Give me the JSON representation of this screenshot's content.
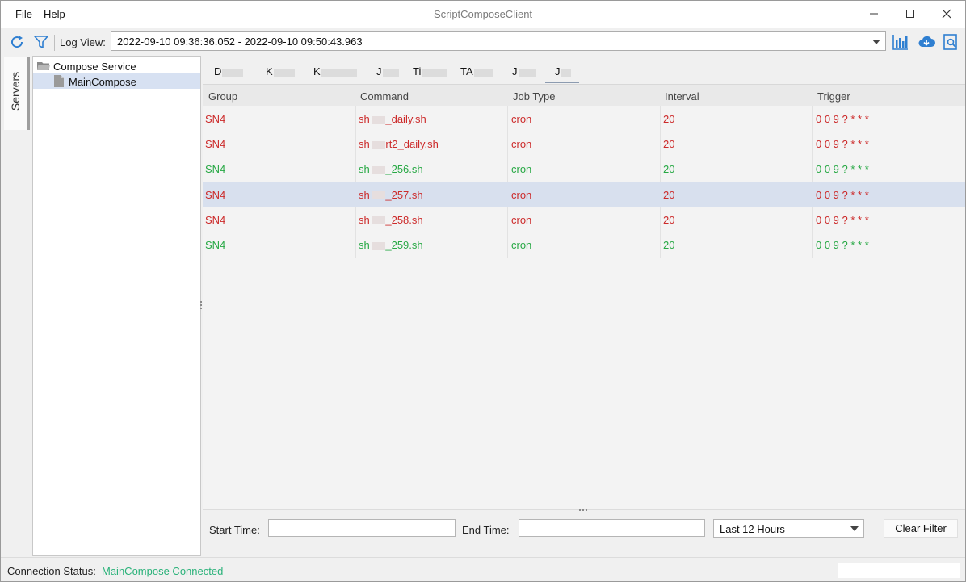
{
  "window": {
    "title": "ScriptComposeClient"
  },
  "menu": {
    "file": "File",
    "help": "Help"
  },
  "toolbar": {
    "refresh_icon": "refresh-icon",
    "filter_icon": "filter-icon",
    "log_view_label": "Log View:",
    "log_view_value": "2022-09-10 09:36:36.052 - 2022-09-10 09:50:43.963",
    "chart_icon": "chart-icon",
    "download_icon": "cloud-download-icon",
    "report_icon": "search-report-icon"
  },
  "sidebar": {
    "servers_tab": "Servers"
  },
  "tree": {
    "root": "Compose Service",
    "child": "MainCompose"
  },
  "tabs": [
    {
      "label": "D"
    },
    {
      "label": "K"
    },
    {
      "label": "K"
    },
    {
      "label": "J"
    },
    {
      "label": "Ti"
    },
    {
      "label": "TA"
    },
    {
      "label": "J"
    },
    {
      "label": "J"
    }
  ],
  "table": {
    "headers": [
      "Group",
      "Command",
      "Job Type",
      "Interval",
      "Trigger"
    ],
    "rows": [
      {
        "group": "SN4",
        "cmd_prefix": "sh",
        "cmd_suffix": "_daily.sh",
        "job_type": "cron",
        "interval": "20",
        "trigger": "0 0 9 ? * * *",
        "status": "red"
      },
      {
        "group": "SN4",
        "cmd_prefix": "sh",
        "cmd_suffix": "rt2_daily.sh",
        "job_type": "cron",
        "interval": "20",
        "trigger": "0 0 9 ? * * *",
        "status": "red"
      },
      {
        "group": "SN4",
        "cmd_prefix": "sh",
        "cmd_suffix": "_256.sh",
        "job_type": "cron",
        "interval": "20",
        "trigger": "0 0 9 ? * * *",
        "status": "green"
      },
      {
        "group": "SN4",
        "cmd_prefix": "sh",
        "cmd_suffix": "_257.sh",
        "job_type": "cron",
        "interval": "20",
        "trigger": "0 0 9 ? * * *",
        "status": "red"
      },
      {
        "group": "SN4",
        "cmd_prefix": "sh",
        "cmd_suffix": "_258.sh",
        "job_type": "cron",
        "interval": "20",
        "trigger": "0 0 9 ? * * *",
        "status": "red"
      },
      {
        "group": "SN4",
        "cmd_prefix": "sh",
        "cmd_suffix": "_259.sh",
        "job_type": "cron",
        "interval": "20",
        "trigger": "0 0 9 ? * * *",
        "status": "green"
      }
    ]
  },
  "filter": {
    "start_label": "Start Time:",
    "start_value": "",
    "end_label": "End Time:",
    "end_value": "",
    "range_value": "Last 12 Hours",
    "clear_button": "Clear Filter"
  },
  "status": {
    "label": "Connection Status:",
    "value": "MainCompose Connected"
  },
  "colors": {
    "accent": "#2f7fd1",
    "error_row": "#cc2a2a",
    "ok_row": "#27a844",
    "status_ok": "#2bb27a",
    "selection": "#d8e0ee"
  }
}
